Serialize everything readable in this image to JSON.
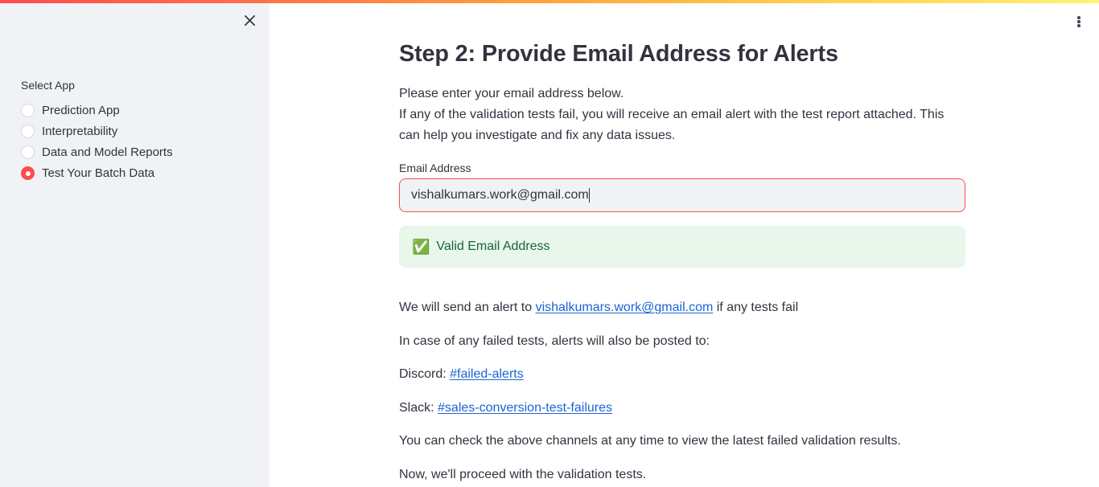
{
  "theme": {
    "accent": "#FF4B4B",
    "sidebar_bg": "#F0F2F6",
    "text": "#31333F",
    "link": "#1C63D3",
    "success_bg": "#E8F6EC",
    "success_text": "#17663A",
    "gradient_from": "#FF4B4B",
    "gradient_to": "#FFF275"
  },
  "topbar": {
    "menu_icon": "more-vertical-icon",
    "sidebar_close_icon": "close-icon"
  },
  "sidebar": {
    "radio_group_label": "Select App",
    "options": [
      {
        "label": "Prediction App",
        "selected": false
      },
      {
        "label": "Interpretability",
        "selected": false
      },
      {
        "label": "Data and Model Reports",
        "selected": false
      },
      {
        "label": "Test Your Batch Data",
        "selected": true
      }
    ]
  },
  "main": {
    "title": "Step 2: Provide Email Address for Alerts",
    "intro_line_1": "Please enter your email address below.",
    "intro_line_2": "If any of the validation tests fail, you will receive an email alert with the test report attached. This can help you investigate and fix any data issues.",
    "email_field": {
      "label": "Email Address",
      "value": "vishalkumars.work@gmail.com",
      "placeholder": "Enter your email"
    },
    "validation": {
      "icon": "white-heavy-check-mark-emoji",
      "glyph": "✅",
      "message": "Valid Email Address"
    },
    "alert_line": {
      "prefix": "We will send an alert to ",
      "email_link": "vishalkumars.work@gmail.com",
      "suffix": " if any tests fail"
    },
    "channels_intro": "In case of any failed tests, alerts will also be posted to:",
    "discord": {
      "prefix": "Discord: ",
      "channel": "#failed-alerts"
    },
    "slack": {
      "prefix": "Slack: ",
      "channel": "#sales-conversion-test-failures"
    },
    "note_check": "You can check the above channels at any time to view the latest failed validation results.",
    "note_proceed": "Now, we'll proceed with the validation tests."
  }
}
